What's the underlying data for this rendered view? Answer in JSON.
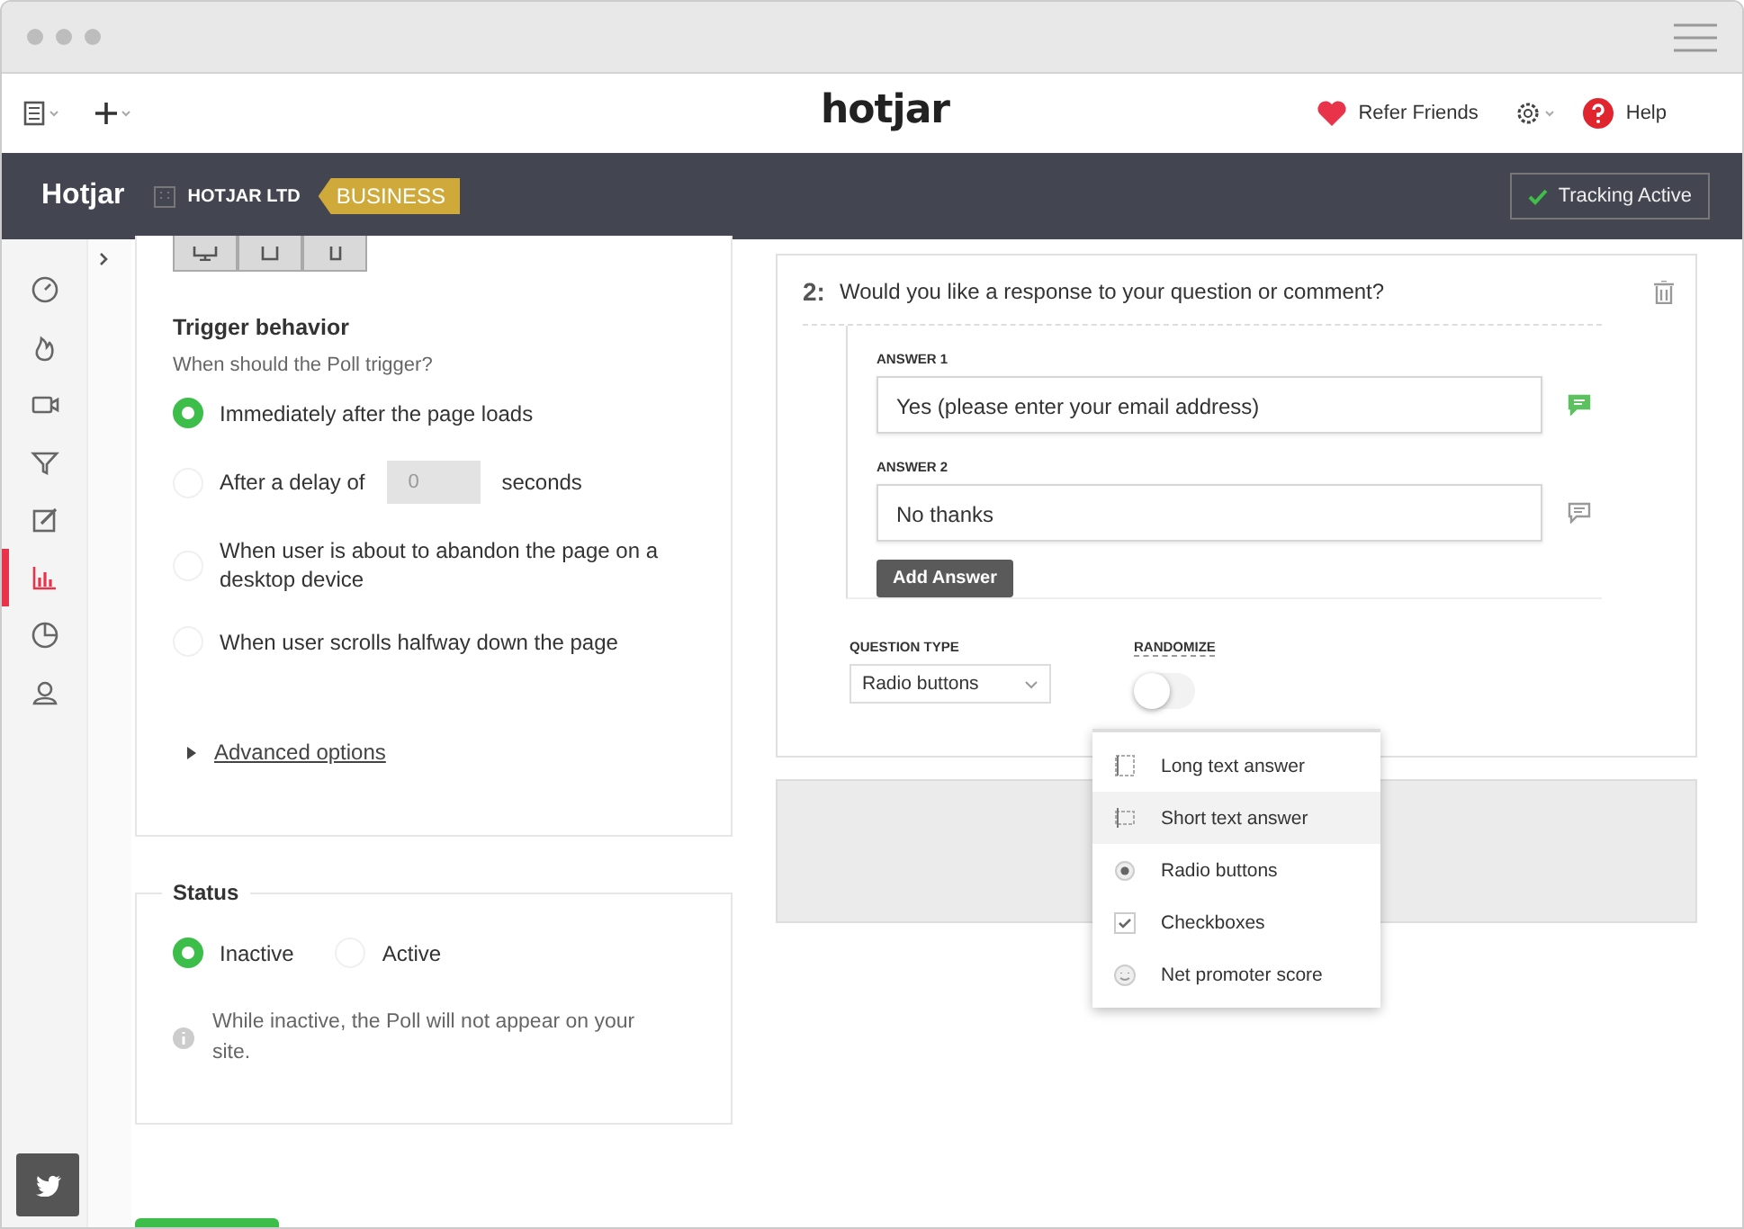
{
  "top_nav": {
    "logo": "hotjar",
    "refer": "Refer Friends",
    "help": "Help"
  },
  "account_bar": {
    "title": "Hotjar",
    "org": "HOTJAR LTD",
    "plan": "BUSINESS",
    "tracking": "Tracking Active"
  },
  "sidebar": {
    "items": [
      {
        "kind": "dashboard",
        "selected": false
      },
      {
        "kind": "heatmap",
        "selected": false
      },
      {
        "kind": "recording",
        "selected": false
      },
      {
        "kind": "funnel",
        "selected": false
      },
      {
        "kind": "form",
        "selected": false
      },
      {
        "kind": "poll",
        "selected": true
      },
      {
        "kind": "survey",
        "selected": false
      },
      {
        "kind": "recruit",
        "selected": false
      }
    ]
  },
  "trigger": {
    "title": "Trigger behavior",
    "subtitle": "When should the Poll trigger?",
    "options": [
      {
        "kind": "plain",
        "label": "Immediately after the page loads",
        "selected": true
      },
      {
        "kind": "delay",
        "label": "After a delay of",
        "placeholder": "0",
        "suffix": "seconds",
        "selected": false
      },
      {
        "kind": "plain",
        "label": "When user is about to abandon the page on a desktop device",
        "selected": false
      },
      {
        "kind": "plain",
        "label": "When user scrolls halfway down the page",
        "selected": false
      }
    ],
    "advanced": "Advanced options"
  },
  "status": {
    "legend": "Status",
    "options": [
      {
        "label": "Inactive",
        "selected": true
      },
      {
        "label": "Active",
        "selected": false
      }
    ],
    "note": "While inactive, the Poll will not appear on your site."
  },
  "question": {
    "number": "2:",
    "text": "Would you like a response to your question or comment?",
    "answers": [
      {
        "label": "ANSWER 1",
        "value": "Yes (please enter your email address)",
        "comment_on": true
      },
      {
        "label": "ANSWER 2",
        "value": "No thanks",
        "comment_on": false
      }
    ],
    "add_answer": "Add Answer",
    "type_label": "QUESTION TYPE",
    "type_value": "Radio buttons",
    "randomize_label": "RANDOMIZE",
    "randomize_on": false
  },
  "type_menu": [
    {
      "kind": "long",
      "label": "Long text answer",
      "highlighted": false
    },
    {
      "kind": "short",
      "label": "Short text answer",
      "highlighted": true
    },
    {
      "kind": "radio",
      "label": "Radio buttons",
      "highlighted": false
    },
    {
      "kind": "check",
      "label": "Checkboxes",
      "highlighted": false
    },
    {
      "kind": "nps",
      "label": "Net promoter score",
      "highlighted": false
    }
  ]
}
